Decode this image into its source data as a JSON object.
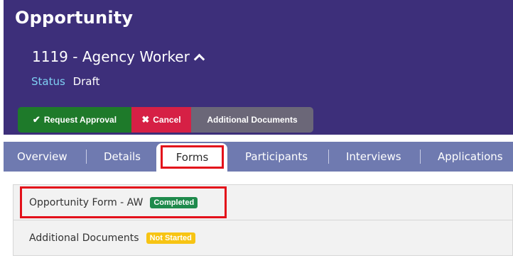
{
  "header": {
    "page_title": "Opportunity",
    "record_title": "1119 - Agency Worker",
    "status_label": "Status",
    "status_value": "Draft"
  },
  "actions": {
    "request_approval": "Request Approval",
    "cancel": "Cancel",
    "additional_documents": "Additional Documents"
  },
  "tabs": [
    {
      "label": "Overview"
    },
    {
      "label": "Details"
    },
    {
      "label": "Forms",
      "active": true
    },
    {
      "label": "Participants"
    },
    {
      "label": "Interviews"
    },
    {
      "label": "Applications"
    }
  ],
  "forms": [
    {
      "name": "Opportunity Form - AW",
      "status": "Completed",
      "status_color": "#1f8a4c"
    },
    {
      "name": "Additional Documents",
      "status": "Not Started",
      "status_color": "#f7c414"
    }
  ],
  "colors": {
    "header_bg": "#3d2f7a",
    "tabbar_bg": "#6f7ab0",
    "highlight": "#e3101a"
  }
}
